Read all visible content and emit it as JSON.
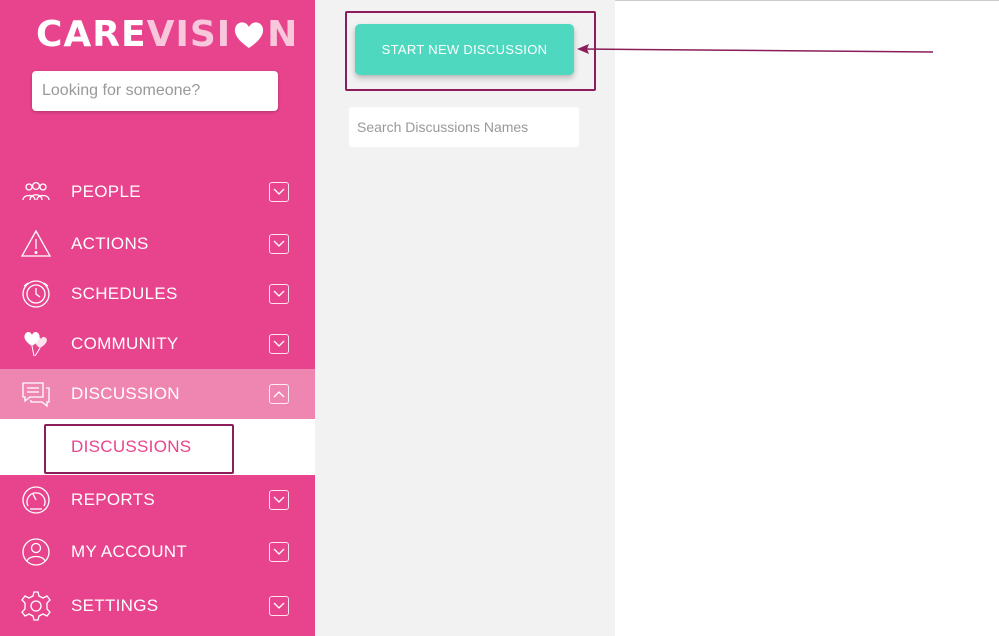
{
  "app": {
    "logo_part1": "CARE",
    "logo_part2": "VISI",
    "logo_part3": "N",
    "colors": {
      "sidebar": "#e8448d",
      "sidebar_active": "#ef85b1",
      "accent_button": "#4fd8c0",
      "highlight_box": "#8b1d5b"
    }
  },
  "sidebar": {
    "search_placeholder": "Looking for someone?",
    "items": [
      {
        "label": "PEOPLE",
        "icon": "people-icon",
        "chevron": "chevron-down-icon"
      },
      {
        "label": "ACTIONS",
        "icon": "warning-icon",
        "chevron": "chevron-down-icon"
      },
      {
        "label": "SCHEDULES",
        "icon": "clock-icon",
        "chevron": "chevron-down-icon"
      },
      {
        "label": "COMMUNITY",
        "icon": "hearts-icon",
        "chevron": "chevron-down-icon"
      },
      {
        "label": "DISCUSSION",
        "icon": "chat-icon",
        "chevron": "chevron-up-icon",
        "active": true
      },
      {
        "label": "REPORTS",
        "icon": "gauge-icon",
        "chevron": "chevron-down-icon"
      },
      {
        "label": "MY ACCOUNT",
        "icon": "user-icon",
        "chevron": "chevron-down-icon"
      },
      {
        "label": "SETTINGS",
        "icon": "gear-icon",
        "chevron": "chevron-down-icon"
      }
    ],
    "submenu": {
      "label": "DISCUSSIONS"
    }
  },
  "main": {
    "start_button_label": "START NEW DISCUSSION",
    "search_placeholder": "Search Discussions Names"
  }
}
